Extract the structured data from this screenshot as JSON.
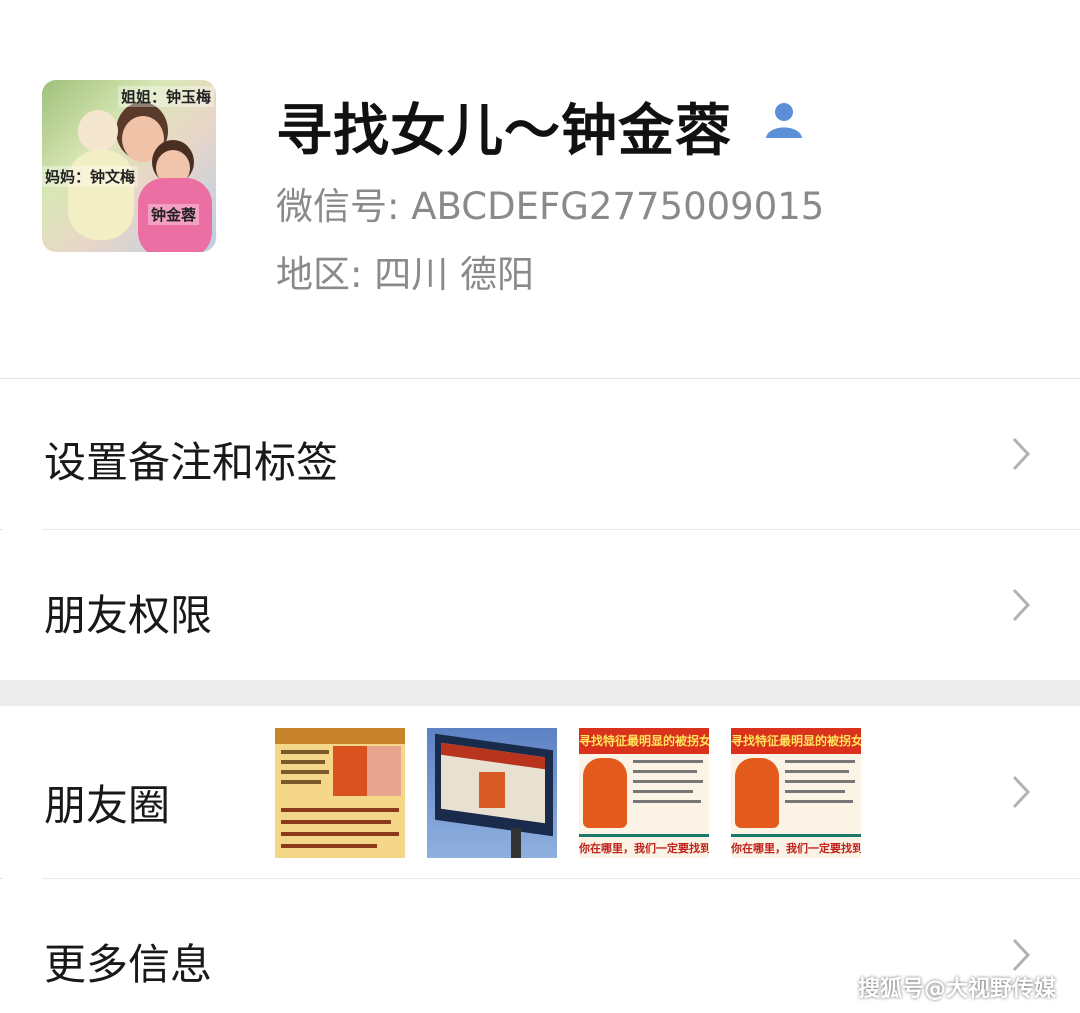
{
  "profile": {
    "name": "寻找女儿～钟金蓉",
    "wechat_id": "微信号: ABCDEFG2775009015",
    "region": "地区: 四川  德阳",
    "avatar_captions": [
      "姐姐：钟玉梅",
      "妈妈：钟文梅",
      "钟金蓉"
    ]
  },
  "menu": {
    "remarks_tags": "设置备注和标签",
    "friend_permissions": "朋友权限",
    "moments": "朋友圈",
    "more_info": "更多信息"
  },
  "moments_thumbnails": [
    {
      "icon": "missing-person-flyer"
    },
    {
      "icon": "billboard-photo"
    },
    {
      "title": "寻找特征最明显的被拐女儿钟",
      "footer": "你在哪里，我们一定要找到"
    },
    {
      "title": "寻找特征最明显的被拐女儿钟",
      "footer": "你在哪里，我们一定要找到"
    }
  ],
  "watermark": "搜狐号@大视野传媒",
  "colors": {
    "accent": "#5b8fd8",
    "secondary_text": "#8a8a8a",
    "gap": "#ededed"
  }
}
